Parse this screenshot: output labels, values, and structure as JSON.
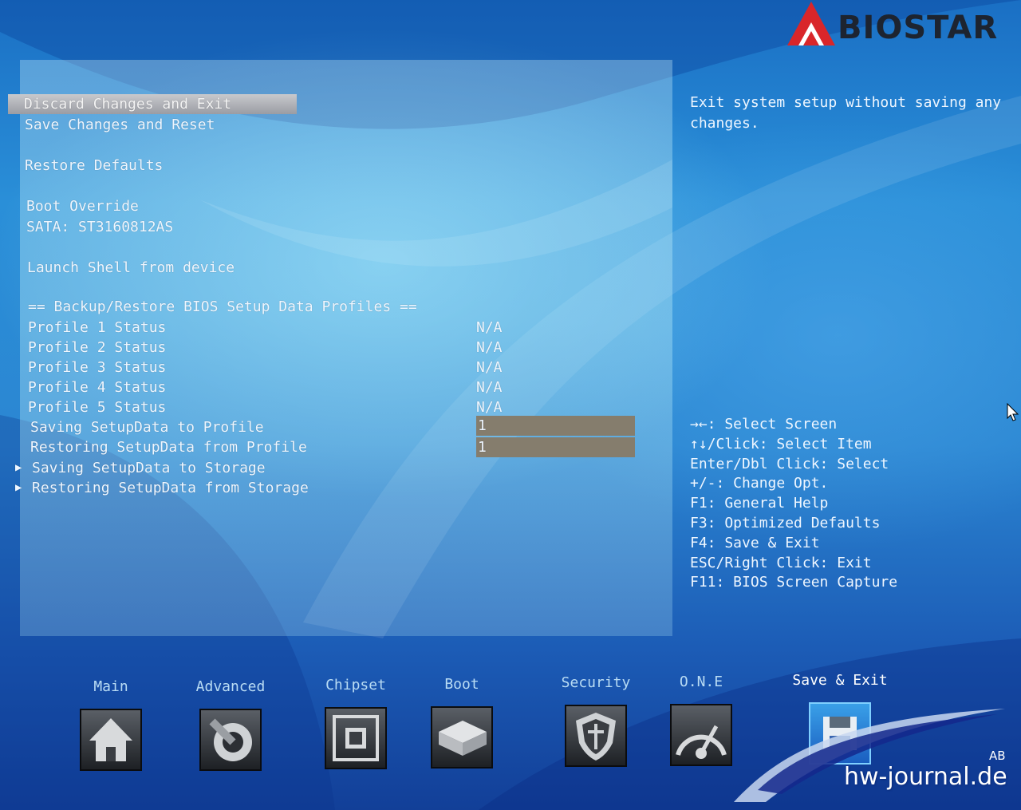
{
  "brand": {
    "name": "BIOSTAR"
  },
  "menu": {
    "items": [
      {
        "label": "Discard Changes and Exit",
        "selected": true
      },
      {
        "label": "Save Changes and Reset"
      },
      {
        "label": "Restore Defaults"
      },
      {
        "label": "Boot Override"
      },
      {
        "label": "SATA: ST3160812AS"
      },
      {
        "label": "Launch Shell from device"
      },
      {
        "label": "== Backup/Restore BIOS Setup Data Profiles =="
      },
      {
        "label": "Profile 1 Status",
        "value": "N/A"
      },
      {
        "label": "Profile 2 Status",
        "value": "N/A"
      },
      {
        "label": "Profile 3 Status",
        "value": "N/A"
      },
      {
        "label": "Profile 4 Status",
        "value": "N/A"
      },
      {
        "label": "Profile 5 Status",
        "value": "N/A"
      },
      {
        "label": "Saving SetupData to Profile",
        "value": "1"
      },
      {
        "label": "Restoring SetupData from Profile",
        "value": "1"
      },
      {
        "label": "Saving SetupData to Storage",
        "submenu": true
      },
      {
        "label": "Restoring SetupData from Storage",
        "submenu": true
      }
    ]
  },
  "help": {
    "text": "Exit system setup without saving any changes."
  },
  "keys": [
    "→←: Select Screen",
    "↑↓/Click: Select Item",
    "Enter/Dbl Click: Select",
    "+/-: Change Opt.",
    "F1: General Help",
    "F3: Optimized Defaults",
    "F4: Save & Exit",
    "ESC/Right Click: Exit",
    "F11: BIOS Screen Capture"
  ],
  "tabs": [
    {
      "label": "Main",
      "icon": "home-icon"
    },
    {
      "label": "Advanced",
      "icon": "advanced-icon"
    },
    {
      "label": "Chipset",
      "icon": "chip-icon"
    },
    {
      "label": "Boot",
      "icon": "drive-icon"
    },
    {
      "label": "Security",
      "icon": "shield-icon"
    },
    {
      "label": "O.N.E",
      "icon": "gauge-icon"
    },
    {
      "label": "Save & Exit",
      "icon": "save-exit-icon",
      "active": true
    }
  ],
  "watermark": {
    "text": "hw-journal.de",
    "initials": "AB"
  },
  "colors": {
    "selected_bar": "#a8aab0",
    "value_box": "#857d6d",
    "text": "#eef6ff",
    "tab_label": "#b9dcf4"
  }
}
